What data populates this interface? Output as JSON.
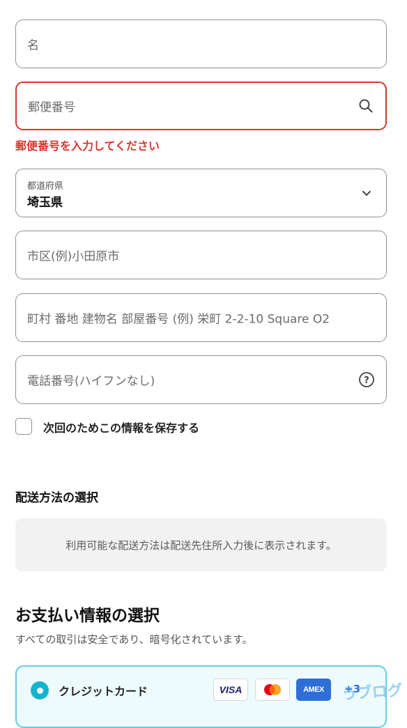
{
  "form": {
    "first_name": {
      "placeholder": "名"
    },
    "postal_code": {
      "placeholder": "郵便番号",
      "error": "郵便番号を入力してください",
      "icon": "search-icon"
    },
    "prefecture": {
      "label": "都道府県",
      "value": "埼玉県",
      "icon": "chevron-down-icon"
    },
    "city": {
      "placeholder": "市区(例)小田原市"
    },
    "address": {
      "placeholder": "町村 番地 建物名 部屋番号 (例) 栄町 2-2-10 Square O2"
    },
    "phone": {
      "placeholder": "電話番号(ハイフンなし)",
      "icon": "help-circle-icon"
    },
    "save_info": {
      "label": "次回のためこの情報を保存する",
      "checked": false
    }
  },
  "shipping": {
    "title": "配送方法の選択",
    "notice": "利用可能な配送方法は配送先住所入力後に表示されます。"
  },
  "payment": {
    "title": "お支払い情報の選択",
    "subtitle": "すべての取引は安全であり、暗号化されています。",
    "option": {
      "label": "クレジットカード",
      "selected": true,
      "brands": [
        "VISA",
        "mastercard",
        "AMEX"
      ],
      "more": "+3"
    }
  },
  "watermark": "うブログ",
  "colors": {
    "error": "#d8362f",
    "accent": "#12b4cc",
    "border": "#8f8f8f"
  }
}
